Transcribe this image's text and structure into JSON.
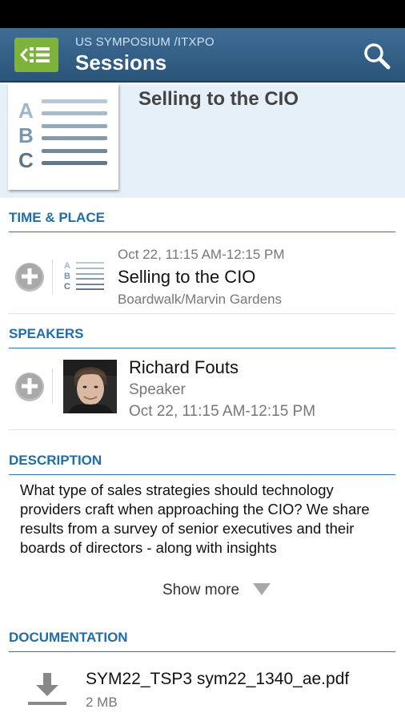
{
  "action_bar": {
    "subtitle": "US SYMPOSIUM /ITXPO",
    "title": "Sessions"
  },
  "header": {
    "session_title": "Selling to the CIO",
    "thumb_letters": [
      "A",
      "B",
      "C"
    ]
  },
  "time_place": {
    "heading": "TIME & PLACE",
    "time": "Oct 22, 11:15 AM-12:15 PM",
    "title": "Selling to the CIO",
    "location": "Boardwalk/Marvin Gardens",
    "icon_letters": [
      "A",
      "B",
      "C"
    ]
  },
  "speakers": {
    "heading": "SPEAKERS",
    "name": "Richard Fouts",
    "role": "Speaker",
    "time": "Oct 22, 11:15 AM-12:15 PM"
  },
  "description": {
    "heading": "DESCRIPTION",
    "text": "What type of sales strategies should technology providers craft when approaching the CIO? We share results from a survey of senior executives and their boards of directors - along with insights",
    "show_more": "Show more"
  },
  "documentation": {
    "heading": "DOCUMENTATION",
    "file_name": "SYM22_TSP3 sym22_1340_ae.pdf",
    "file_size": "2 MB"
  },
  "colors": {
    "action_bar": "#2f5b82",
    "accent": "#1f6ea8",
    "app_icon": "#7db33a",
    "header_bg": "#e6f0f8"
  },
  "icons": {
    "app": "list-back-icon",
    "search": "search-icon",
    "add": "plus-circle-icon",
    "session": "abc-list-icon",
    "download": "download-icon",
    "expand": "triangle-down-icon"
  }
}
